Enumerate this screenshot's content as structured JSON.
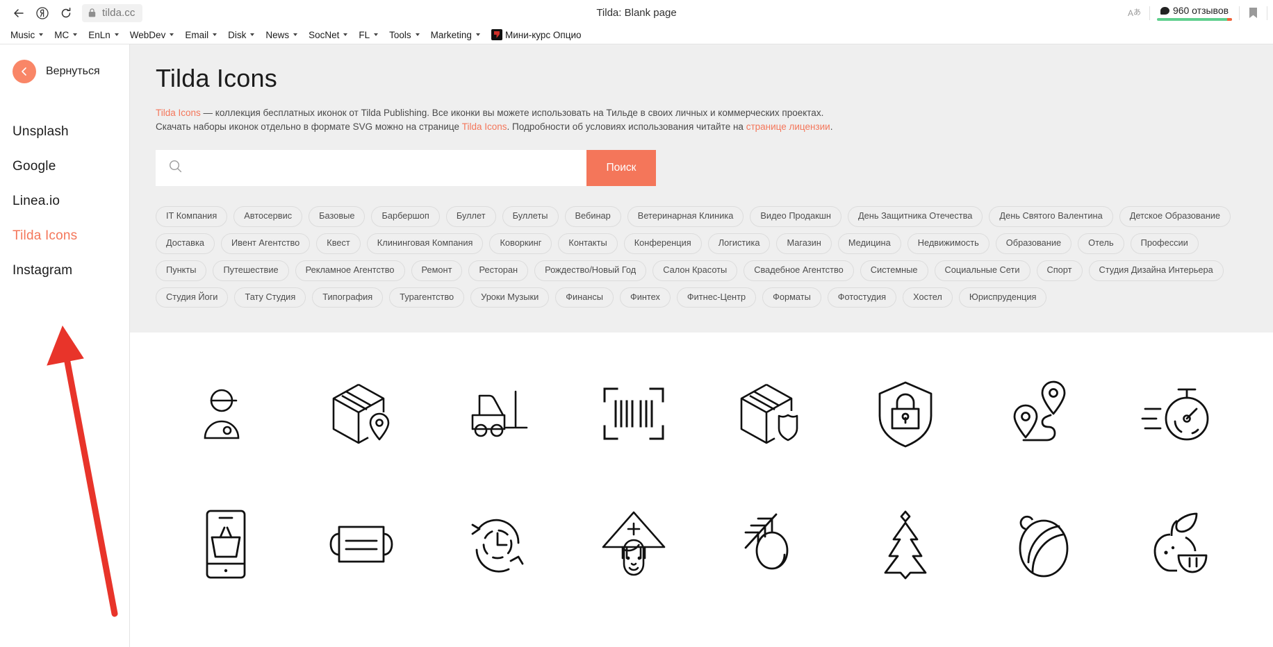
{
  "browser": {
    "title": "Tilda: Blank page",
    "url": "tilda.cc",
    "back_icon": "back-arrow-icon",
    "profile_icon": "yandex-profile-icon",
    "reload_icon": "reload-icon",
    "lock_icon": "lock-icon",
    "translate_label": "A",
    "translate_sup": "あ",
    "reviews_label": "960 отзывов",
    "bookmark_icon": "bookmark-icon",
    "bookmarks": [
      {
        "label": "Music",
        "has_caret": true
      },
      {
        "label": "MC",
        "has_caret": true
      },
      {
        "label": "EnLn",
        "has_caret": true
      },
      {
        "label": "WebDev",
        "has_caret": true
      },
      {
        "label": "Email",
        "has_caret": true
      },
      {
        "label": "Disk",
        "has_caret": true
      },
      {
        "label": "News",
        "has_caret": true
      },
      {
        "label": "SocNet",
        "has_caret": true
      },
      {
        "label": "FL",
        "has_caret": true
      },
      {
        "label": "Tools",
        "has_caret": true
      },
      {
        "label": "Marketing",
        "has_caret": true
      },
      {
        "label": "Мини-курс Опцио",
        "has_caret": false,
        "favicon": true
      }
    ]
  },
  "sidebar": {
    "back_label": "Вернуться",
    "items": [
      {
        "label": "Unsplash",
        "active": false
      },
      {
        "label": "Google",
        "active": false
      },
      {
        "label": "Linea.io",
        "active": false
      },
      {
        "label": "Tilda Icons",
        "active": true
      },
      {
        "label": "Instagram",
        "active": false
      }
    ]
  },
  "main": {
    "heading": "Tilda Icons",
    "description": {
      "link1": "Tilda Icons",
      "part1": " — коллекция бесплатных иконок от Tilda Publishing. Все иконки вы можете использовать на Тильде в своих личных и коммерческих проектах. Скачать наборы иконок отдельно в формате SVG можно на странице ",
      "link2": "Tilda Icons",
      "part2": ". Подробности об условиях использования читайте на ",
      "link3": "странице лицензии",
      "part3": "."
    },
    "search": {
      "value": "",
      "placeholder": "",
      "button_label": "Поиск",
      "icon": "search-icon"
    },
    "tags": [
      "IT Компания",
      "Автосервис",
      "Базовые",
      "Барбершоп",
      "Буллет",
      "Буллеты",
      "Вебинар",
      "Ветеринарная Клиника",
      "Видео Продакшн",
      "День Защитника Отечества",
      "День Святого Валентина",
      "Детское Образование",
      "Доставка",
      "Ивент Агентство",
      "Квест",
      "Клининговая Компания",
      "Коворкинг",
      "Контакты",
      "Конференция",
      "Логистика",
      "Магазин",
      "Медицина",
      "Недвижимость",
      "Образование",
      "Отель",
      "Профессии",
      "Пункты",
      "Путешествие",
      "Рекламное Агентство",
      "Ремонт",
      "Ресторан",
      "Рождество/Новый Год",
      "Салон Красоты",
      "Свадебное Агентство",
      "Системные",
      "Социальные Сети",
      "Спорт",
      "Студия Дизайна Интерьера",
      "Студия Йоги",
      "Тату Студия",
      "Типография",
      "Турагентство",
      "Уроки Музыки",
      "Финансы",
      "Финтех",
      "Фитнес-Центр",
      "Форматы",
      "Фотостудия",
      "Хостел",
      "Юриспруденция"
    ],
    "icons": [
      {
        "name": "courier-person-icon"
      },
      {
        "name": "package-location-icon"
      },
      {
        "name": "forklift-icon"
      },
      {
        "name": "barcode-scan-icon"
      },
      {
        "name": "package-shield-icon"
      },
      {
        "name": "shield-lock-icon"
      },
      {
        "name": "route-pins-icon"
      },
      {
        "name": "fast-stopwatch-icon"
      },
      {
        "name": "mobile-shopping-basket-icon"
      },
      {
        "name": "face-mask-icon"
      },
      {
        "name": "clock-refresh-icon"
      },
      {
        "name": "girl-in-hood-icon"
      },
      {
        "name": "branch-bauble-icon"
      },
      {
        "name": "christmas-tree-icon"
      },
      {
        "name": "christmas-ball-icon"
      },
      {
        "name": "apple-citrus-icon"
      }
    ]
  },
  "annotation": {
    "arrow_color": "#e8342a",
    "name": "red-arrow-annotation"
  }
}
